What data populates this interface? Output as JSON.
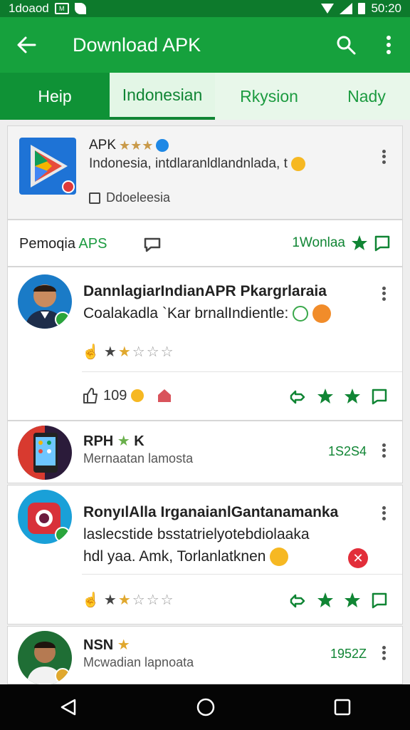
{
  "status_bar": {
    "left_text": "1doaod",
    "time": "50:20"
  },
  "app_bar": {
    "title": "Download APK"
  },
  "tabs": [
    {
      "label": "Heip"
    },
    {
      "label": "Indonesian"
    },
    {
      "label": "Rkysion"
    },
    {
      "label": "Nady"
    }
  ],
  "top_card": {
    "title": "APK",
    "description": "Indonesia, intdlaranldlandnlada, t",
    "checkbox_label": "Ddoeleesia"
  },
  "section": {
    "title_prefix": "Pemoqia",
    "title_suffix": "APS",
    "right_label": "1Wonlaa"
  },
  "posts": [
    {
      "lines": [
        "DannlagiarIndianAPR Pkargrlaraia",
        "Coalakadla `Kar brnalIndientle:"
      ],
      "count": "109"
    },
    {
      "title": "RPH",
      "title_suffix": "K",
      "subtitle": "Mernaatan lamosta",
      "number": "1S2S4"
    },
    {
      "lines": [
        "RonyılAlla IrganaianlGantanamanka",
        "laslecstide bsstatrielyotebdiolaaka",
        "hdl yaa. Amk, Torlanlatknen"
      ]
    },
    {
      "title": "NSN",
      "subtitle": "Mcwadian lapnoata",
      "number": "1952Z"
    }
  ],
  "colors": {
    "primary": "#16a13d",
    "primary_dark": "#0d7a2c",
    "accent_green": "#108534",
    "star_gold": "#e0a82e"
  }
}
